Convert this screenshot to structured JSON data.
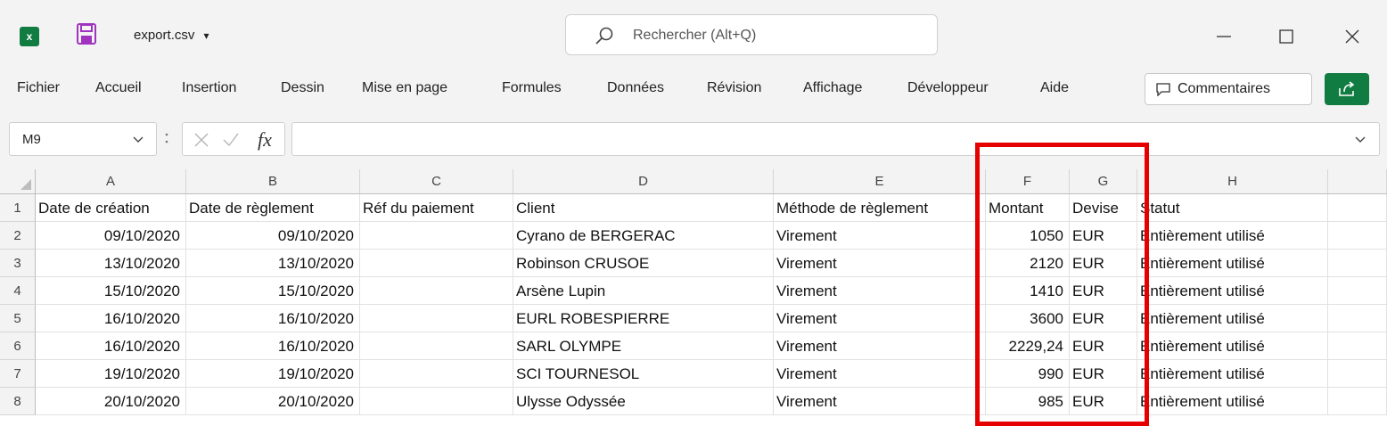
{
  "window": {
    "filename": "export.csv",
    "filename_dropdown": "▾",
    "app_badge": "x"
  },
  "search": {
    "placeholder": "Rechercher (Alt+Q)"
  },
  "menu": [
    "Fichier",
    "Accueil",
    "Insertion",
    "Dessin",
    "Mise en page",
    "Formules",
    "Données",
    "Révision",
    "Affichage",
    "Développeur",
    "Aide"
  ],
  "comments_label": "Commentaires",
  "formula_bar": {
    "name_box": "M9",
    "fx": "fx",
    "value": ""
  },
  "columns": [
    "A",
    "B",
    "C",
    "D",
    "E",
    "F",
    "G",
    "H"
  ],
  "rows": [
    "1",
    "2",
    "3",
    "4",
    "5",
    "6",
    "7",
    "8"
  ],
  "table": [
    [
      "Date de création",
      "Date de règlement",
      "Réf du paiement",
      "Client",
      "Méthode de règlement",
      "Montant",
      "Devise",
      "Statut"
    ],
    [
      "09/10/2020",
      "09/10/2020",
      "",
      "Cyrano de BERGERAC",
      "Virement",
      "1050",
      "EUR",
      "Entièrement utilisé"
    ],
    [
      "13/10/2020",
      "13/10/2020",
      "",
      "Robinson CRUSOE",
      "Virement",
      "2120",
      "EUR",
      "Entièrement utilisé"
    ],
    [
      "15/10/2020",
      "15/10/2020",
      "",
      "Arsène Lupin",
      "Virement",
      "1410",
      "EUR",
      "Entièrement utilisé"
    ],
    [
      "16/10/2020",
      "16/10/2020",
      "",
      "EURL ROBESPIERRE",
      "Virement",
      "3600",
      "EUR",
      "Entièrement utilisé"
    ],
    [
      "16/10/2020",
      "16/10/2020",
      "",
      "SARL OLYMPE",
      "Virement",
      "2229,24",
      "EUR",
      "Entièrement utilisé"
    ],
    [
      "19/10/2020",
      "19/10/2020",
      "",
      "SCI TOURNESOL",
      "Virement",
      "990",
      "EUR",
      "Entièrement utilisé"
    ],
    [
      "20/10/2020",
      "20/10/2020",
      "",
      "Ulysse Odyssée",
      "Virement",
      "985",
      "EUR",
      "Entièrement utilisé"
    ]
  ],
  "colors": {
    "excel_green": "#107c41",
    "highlight_red": "#e60000"
  }
}
